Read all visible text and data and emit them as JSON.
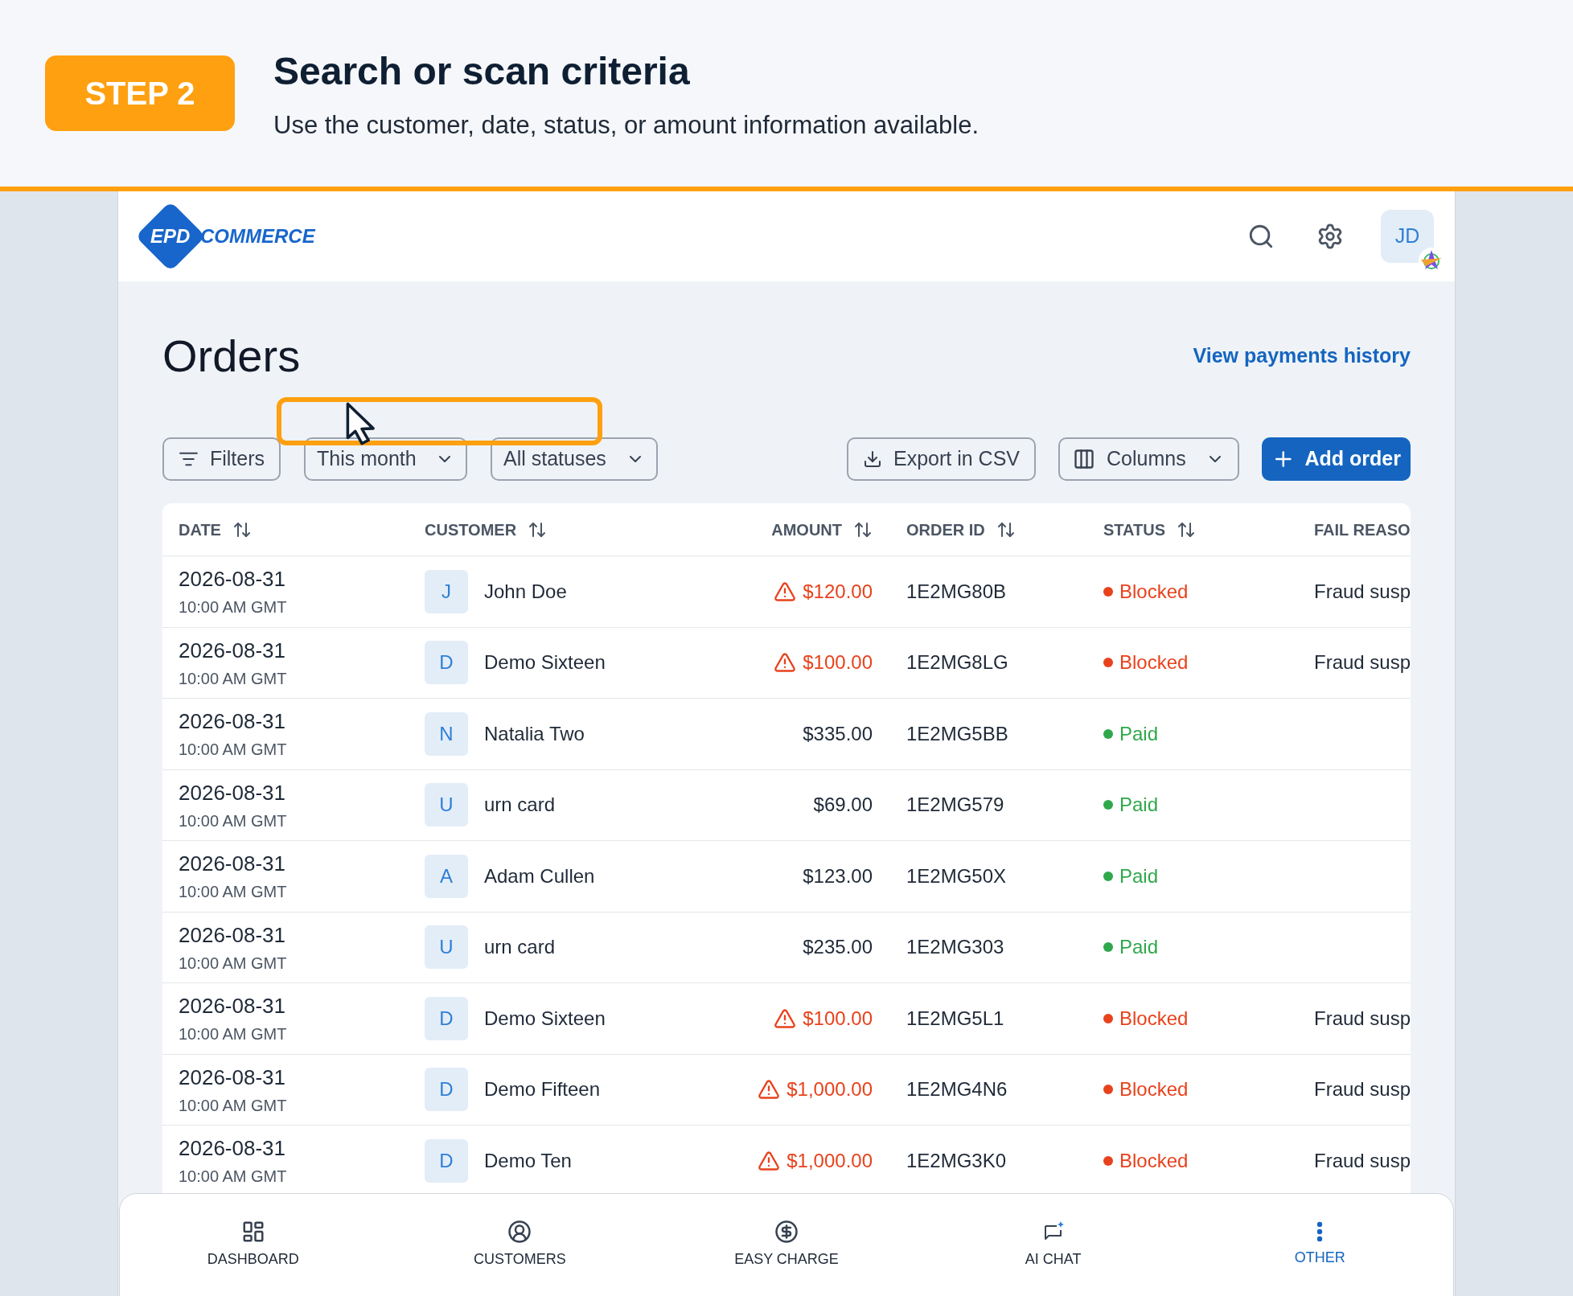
{
  "step": {
    "badge": "STEP 2",
    "title": "Search or scan criteria",
    "subtitle": "Use the customer, date, status, or amount information available."
  },
  "logo": {
    "badge": "EPD",
    "name": "COMMERCE"
  },
  "user": {
    "initials": "JD"
  },
  "page": {
    "title": "Orders",
    "link": "View payments history"
  },
  "toolbar": {
    "filters": "Filters",
    "period": "This month",
    "status": "All statuses",
    "export": "Export in CSV",
    "columns": "Columns",
    "add": "Add order"
  },
  "table": {
    "columns": [
      "DATE",
      "CUSTOMER",
      "AMOUNT",
      "ORDER ID",
      "STATUS",
      "FAIL REASO"
    ],
    "rows": [
      {
        "date": "2026-08-31",
        "time": "10:00 AM GMT",
        "initial": "J",
        "customer": "John Doe",
        "amount": "$120.00",
        "warning": true,
        "order_id": "1E2MG80B",
        "status": "Blocked",
        "kind": "blocked",
        "reason": "Fraud susp"
      },
      {
        "date": "2026-08-31",
        "time": "10:00 AM GMT",
        "initial": "D",
        "customer": "Demo Sixteen",
        "amount": "$100.00",
        "warning": true,
        "order_id": "1E2MG8LG",
        "status": "Blocked",
        "kind": "blocked",
        "reason": "Fraud susp"
      },
      {
        "date": "2026-08-31",
        "time": "10:00 AM GMT",
        "initial": "N",
        "customer": "Natalia Two",
        "amount": "$335.00",
        "warning": false,
        "order_id": "1E2MG5BB",
        "status": "Paid",
        "kind": "paid"
      },
      {
        "date": "2026-08-31",
        "time": "10:00 AM GMT",
        "initial": "U",
        "customer": "urn card",
        "amount": "$69.00",
        "warning": false,
        "order_id": "1E2MG579",
        "status": "Paid",
        "kind": "paid"
      },
      {
        "date": "2026-08-31",
        "time": "10:00 AM GMT",
        "initial": "A",
        "customer": "Adam Cullen",
        "amount": "$123.00",
        "warning": false,
        "order_id": "1E2MG50X",
        "status": "Paid",
        "kind": "paid"
      },
      {
        "date": "2026-08-31",
        "time": "10:00 AM GMT",
        "initial": "U",
        "customer": "urn card",
        "amount": "$235.00",
        "warning": false,
        "order_id": "1E2MG303",
        "status": "Paid",
        "kind": "paid"
      },
      {
        "date": "2026-08-31",
        "time": "10:00 AM GMT",
        "initial": "D",
        "customer": "Demo Sixteen",
        "amount": "$100.00",
        "warning": true,
        "order_id": "1E2MG5L1",
        "status": "Blocked",
        "kind": "blocked",
        "reason": "Fraud susp"
      },
      {
        "date": "2026-08-31",
        "time": "10:00 AM GMT",
        "initial": "D",
        "customer": "Demo Fifteen",
        "amount": "$1,000.00",
        "warning": true,
        "order_id": "1E2MG4N6",
        "status": "Blocked",
        "kind": "blocked",
        "reason": "Fraud susp"
      },
      {
        "date": "2026-08-31",
        "time": "10:00 AM GMT",
        "initial": "D",
        "customer": "Demo Ten",
        "amount": "$1,000.00",
        "warning": true,
        "order_id": "1E2MG3K0",
        "status": "Blocked",
        "kind": "blocked",
        "reason": "Fraud susp"
      }
    ]
  },
  "nav": [
    {
      "label": "DASHBOARD",
      "kind": "dashboard",
      "selected": false
    },
    {
      "label": "CUSTOMERS",
      "kind": "customers",
      "selected": false
    },
    {
      "label": "EASY CHARGE",
      "kind": "charge",
      "selected": false
    },
    {
      "label": "AI CHAT",
      "kind": "chat",
      "selected": false
    },
    {
      "label": "OTHER",
      "kind": "other",
      "selected": true
    }
  ]
}
